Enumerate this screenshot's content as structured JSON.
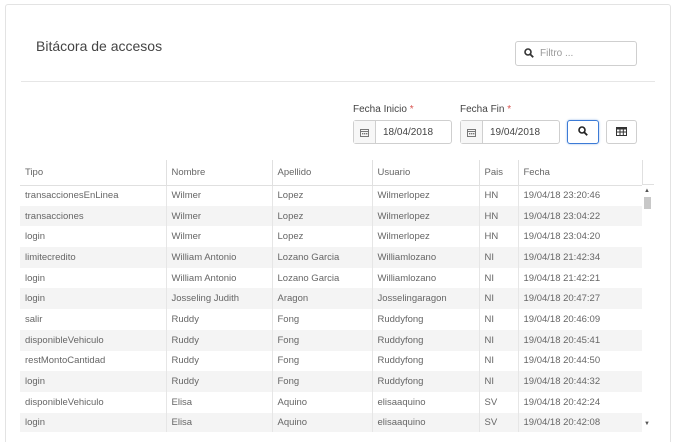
{
  "page": {
    "title": "Bitácora de accesos"
  },
  "filter": {
    "placeholder": "Filtro ..."
  },
  "fecha_inicio": {
    "label": "Fecha Inicio",
    "required_mark": "*",
    "value": "18/04/2018"
  },
  "fecha_fin": {
    "label": "Fecha Fin",
    "required_mark": "*",
    "value": "19/04/2018"
  },
  "colors": {
    "accent": "#3c7bd6",
    "required": "#d9534f"
  },
  "icons": {
    "search": "search-icon",
    "calendar": "calendar-icon",
    "table": "table-icon"
  },
  "table": {
    "columns": [
      "Tipo",
      "Nombre",
      "Apellido",
      "Usuario",
      "Pais",
      "Fecha"
    ],
    "rows": [
      [
        "transaccionesEnLinea",
        "Wilmer",
        "Lopez",
        "Wilmerlopez",
        "HN",
        "19/04/18 23:20:46"
      ],
      [
        "transacciones",
        "Wilmer",
        "Lopez",
        "Wilmerlopez",
        "HN",
        "19/04/18 23:04:22"
      ],
      [
        "login",
        "Wilmer",
        "Lopez",
        "Wilmerlopez",
        "HN",
        "19/04/18 23:04:20"
      ],
      [
        "limitecredito",
        "William Antonio",
        "Lozano Garcia",
        "Williamlozano",
        "NI",
        "19/04/18 21:42:34"
      ],
      [
        "login",
        "William Antonio",
        "Lozano Garcia",
        "Williamlozano",
        "NI",
        "19/04/18 21:42:21"
      ],
      [
        "login",
        "Josseling Judith",
        "Aragon",
        "Josselingaragon",
        "NI",
        "19/04/18 20:47:27"
      ],
      [
        "salir",
        "Ruddy",
        "Fong",
        "Ruddyfong",
        "NI",
        "19/04/18 20:46:09"
      ],
      [
        "disponibleVehiculo",
        "Ruddy",
        "Fong",
        "Ruddyfong",
        "NI",
        "19/04/18 20:45:41"
      ],
      [
        "restMontoCantidad",
        "Ruddy",
        "Fong",
        "Ruddyfong",
        "NI",
        "19/04/18 20:44:50"
      ],
      [
        "login",
        "Ruddy",
        "Fong",
        "Ruddyfong",
        "NI",
        "19/04/18 20:44:32"
      ],
      [
        "disponibleVehiculo",
        "Elisa",
        "Aquino",
        "elisaaquino",
        "SV",
        "19/04/18 20:42:24"
      ],
      [
        "login",
        "Elisa",
        "Aquino",
        "elisaaquino",
        "SV",
        "19/04/18 20:42:08"
      ]
    ]
  }
}
